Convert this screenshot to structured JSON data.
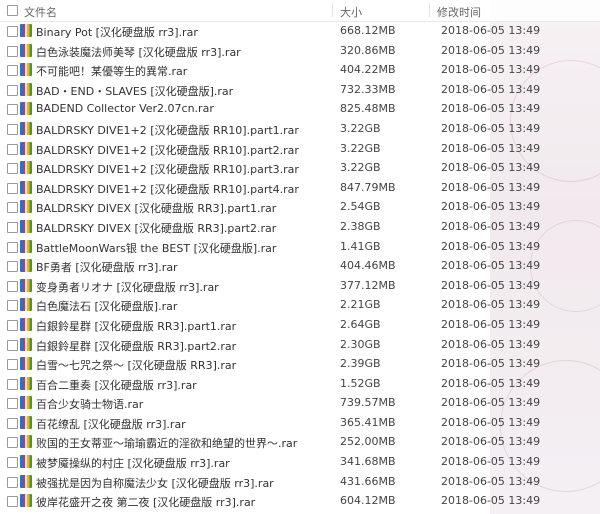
{
  "header": {
    "name_label": "文件名",
    "size_label": "大小",
    "date_label": "修改时间"
  },
  "files": [
    {
      "name": "Binary Pot [汉化硬盘版 rr3].rar",
      "size": "668.12MB",
      "date": "2018-06-05 13:49"
    },
    {
      "name": "白色泳装魔法师美琴 [汉化硬盘版 rr3].rar",
      "size": "320.86MB",
      "date": "2018-06-05 13:49"
    },
    {
      "name": "不可能吧！某優等生的異常.rar",
      "size": "404.22MB",
      "date": "2018-06-05 13:49"
    },
    {
      "name": "BAD・END・SLAVES [汉化硬盘版].rar",
      "size": "732.33MB",
      "date": "2018-06-05 13:49"
    },
    {
      "name": "BADEND Collector Ver2.07cn.rar",
      "size": "825.48MB",
      "date": "2018-06-05 13:49"
    },
    {
      "name": "BALDRSKY DIVE1+2 [汉化硬盘版 RR10].part1.rar",
      "size": "3.22GB",
      "date": "2018-06-05 13:49"
    },
    {
      "name": "BALDRSKY DIVE1+2 [汉化硬盘版 RR10].part2.rar",
      "size": "3.22GB",
      "date": "2018-06-05 13:49"
    },
    {
      "name": "BALDRSKY DIVE1+2 [汉化硬盘版 RR10].part3.rar",
      "size": "3.22GB",
      "date": "2018-06-05 13:49"
    },
    {
      "name": "BALDRSKY DIVE1+2 [汉化硬盘版 RR10].part4.rar",
      "size": "847.79MB",
      "date": "2018-06-05 13:49"
    },
    {
      "name": "BALDRSKY DIVEX [汉化硬盘版 RR3].part1.rar",
      "size": "2.54GB",
      "date": "2018-06-05 13:49"
    },
    {
      "name": "BALDRSKY DIVEX [汉化硬盘版 RR3].part2.rar",
      "size": "2.38GB",
      "date": "2018-06-05 13:49"
    },
    {
      "name": "BattleMoonWars银 the BEST [汉化硬盘版].rar",
      "size": "1.41GB",
      "date": "2018-06-05 13:49"
    },
    {
      "name": "BF勇者 [汉化硬盘版 rr3].rar",
      "size": "404.46MB",
      "date": "2018-06-05 13:49"
    },
    {
      "name": "变身勇者リオナ [汉化硬盘版 rr3].rar",
      "size": "377.12MB",
      "date": "2018-06-05 13:49"
    },
    {
      "name": "白色魔法石 [汉化硬盘版].rar",
      "size": "2.21GB",
      "date": "2018-06-05 13:49"
    },
    {
      "name": "白銀鈴星群 [汉化硬盘版 RR3].part1.rar",
      "size": "2.64GB",
      "date": "2018-06-05 13:49"
    },
    {
      "name": "白銀鈴星群 [汉化硬盘版 RR3].part2.rar",
      "size": "2.30GB",
      "date": "2018-06-05 13:49"
    },
    {
      "name": "白雪～七咒之祭～ [汉化硬盘版 RR3].rar",
      "size": "2.39GB",
      "date": "2018-06-05 13:49"
    },
    {
      "name": "百合二重奏 [汉化硬盘版 rr3].rar",
      "size": "1.52GB",
      "date": "2018-06-05 13:49"
    },
    {
      "name": "百合少女骑士物语.rar",
      "size": "739.57MB",
      "date": "2018-06-05 13:49"
    },
    {
      "name": "百花缭乱 [汉化硬盘版 rr3].rar",
      "size": "365.41MB",
      "date": "2018-06-05 13:49"
    },
    {
      "name": "败国的王女蒂亚～瑜瑜霸近的淫欲和绝望的世界～.rar",
      "size": "252.00MB",
      "date": "2018-06-05 13:49"
    },
    {
      "name": "被梦魇操纵的村庄 [汉化硬盘版 rr3].rar",
      "size": "341.68MB",
      "date": "2018-06-05 13:49"
    },
    {
      "name": "被强扰是因为自称魔法少女 [汉化硬盘版 rr3].rar",
      "size": "431.66MB",
      "date": "2018-06-05 13:49"
    },
    {
      "name": "彼岸花盛开之夜 第二夜 [汉化硬盘版 rr3].rar",
      "size": "604.12MB",
      "date": "2018-06-05 13:49"
    }
  ]
}
